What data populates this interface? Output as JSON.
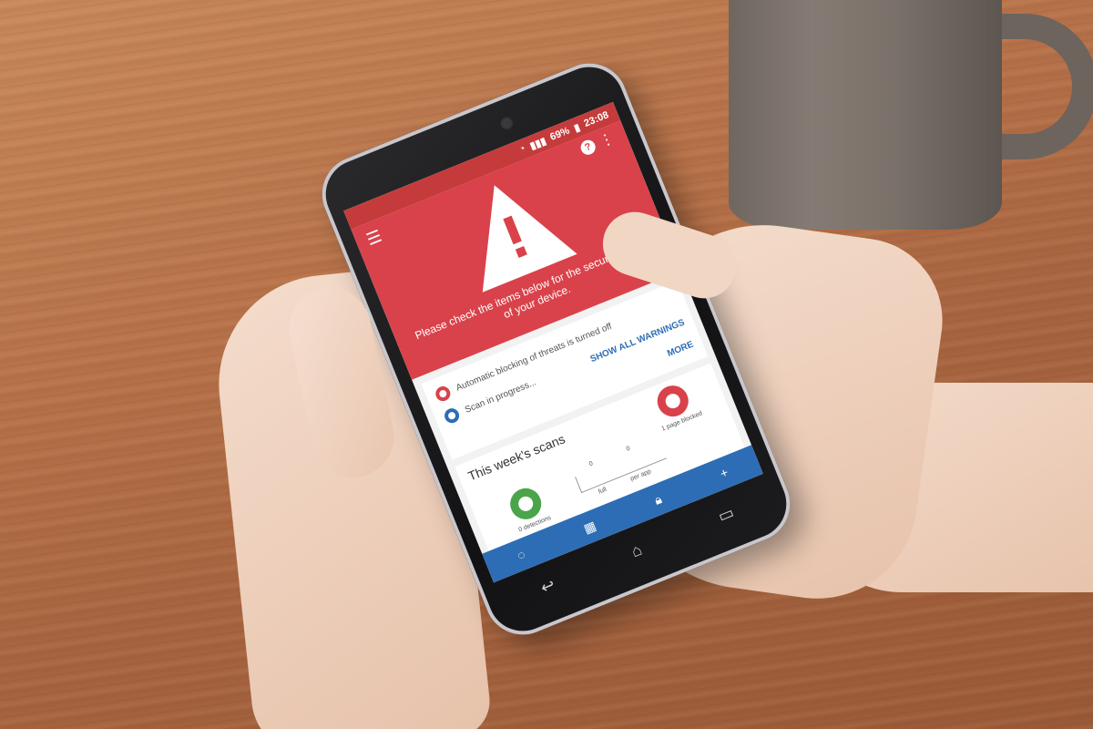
{
  "status_bar": {
    "signal": "▮▮▮",
    "battery": "69%",
    "time": "23:08"
  },
  "header": {
    "menu_icon": "☰",
    "help_icon": "?",
    "more_icon": "⋮",
    "alert_message": "Please check the items below for the security status of your device."
  },
  "warnings": {
    "items": [
      {
        "text": "Automatic blocking of threats is turned off",
        "icon": "red-ring-icon"
      },
      {
        "text": "Scan in progress...",
        "icon": "blue-ring-icon"
      }
    ],
    "show_all_label": "SHOW ALL WARNINGS",
    "more_label": "MORE"
  },
  "scans": {
    "title": "This week's scans",
    "detections_label": "0 detections",
    "blocked_label": "1 page blocked",
    "full_value": "0",
    "full_label": "full",
    "per_app_value": "0",
    "per_app_label": "per app"
  },
  "bottom_nav": {
    "add_icon": "+"
  },
  "soft_keys": {
    "back": "↩",
    "home": "⌂",
    "recents": "▭"
  },
  "colors": {
    "alert_red": "#d9424a",
    "accent_blue": "#2d6db5",
    "ok_green": "#4aa54a"
  }
}
